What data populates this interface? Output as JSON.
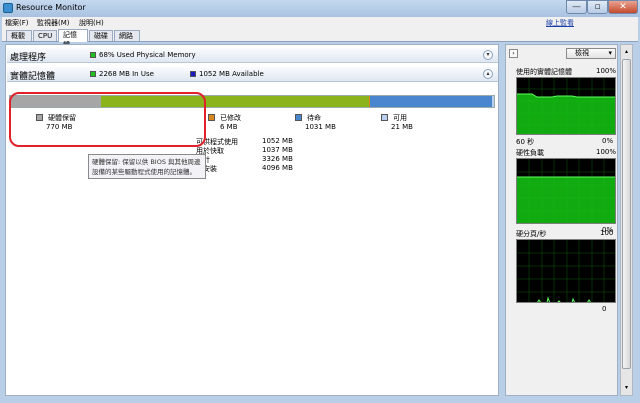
{
  "window": {
    "title": "Resource Monitor",
    "link_label": "線上監看",
    "min_glyph": "—",
    "max_glyph": "▫",
    "close_glyph": "✕"
  },
  "menu": [
    "檔案(F)",
    "監視器(M)",
    "說明(H)"
  ],
  "tabs": [
    "概觀",
    "CPU",
    "記憶體",
    "磁碟",
    "網路"
  ],
  "active_tab": 2,
  "cpu_section": {
    "title": "處理程序",
    "badge": "68% Used Physical Memory",
    "badge_color": "#1fc01f"
  },
  "memory_section": {
    "title": "實體記憶體",
    "in_use_label": "2268 MB In Use",
    "in_use_color": "#1fc01f",
    "available_label": "1052 MB Available",
    "available_color": "#1a1ac0",
    "bar": [
      {
        "name": "reserved",
        "fraction": 0.188,
        "color": "#a6a6a6"
      },
      {
        "name": "in-use",
        "fraction": 0.553,
        "color": "#8bb31b"
      },
      {
        "name": "modified",
        "fraction": 0.002,
        "color": "#d8881c"
      },
      {
        "name": "standby",
        "fraction": 0.252,
        "color": "#4a86d0"
      },
      {
        "name": "free",
        "fraction": 0.005,
        "color": "#b8d0ee"
      }
    ],
    "legend": [
      {
        "label": "硬體保留",
        "value": "770 MB",
        "color": "#a6a6a6"
      },
      {
        "label": "已修改",
        "value": "6 MB",
        "color": "#d8881c"
      },
      {
        "label": "待命",
        "value": "1031 MB",
        "color": "#4a86d0"
      },
      {
        "label": "可用",
        "value": "21 MB",
        "color": "#b8d0ee"
      }
    ],
    "summary": [
      {
        "label": "可供程式使用",
        "value": "1052 MB"
      },
      {
        "label": "用於快取",
        "value": "1037 MB"
      },
      {
        "label": "總計",
        "value": "3326 MB"
      },
      {
        "label": "已安裝",
        "value": "4096 MB"
      }
    ],
    "tooltip_line1": "硬體保留: 保留以供 BIOS 與其他周邊",
    "tooltip_line2": "設備的某些驅動程式使用的記憶體。"
  },
  "right_panel": {
    "views_label": "檢視",
    "graphs": [
      {
        "title": "使用的實體記憶體",
        "max": "100%",
        "footer_left": "60 秒",
        "footer_right": "0%"
      },
      {
        "title": "硬分頁/秒",
        "max": "100",
        "footer_left": "",
        "footer_right": "0"
      }
    ],
    "hard_faults_title": "硬性負載",
    "hard_faults_max": "100%",
    "hard_faults_footer": "0%"
  }
}
